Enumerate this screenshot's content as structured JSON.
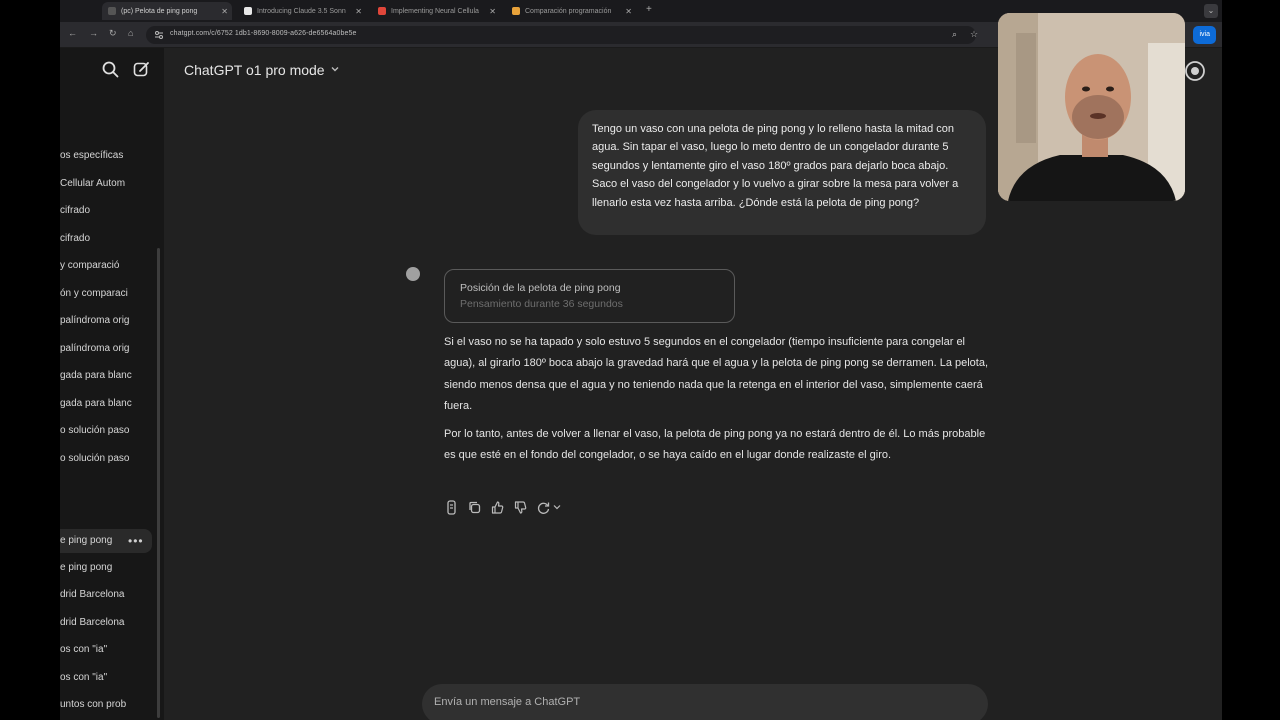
{
  "browser": {
    "tabs": [
      {
        "title": "(pc) Pelota de ping pong",
        "favicon_color": "#3a3a3a"
      },
      {
        "title": "Introducing Claude 3.5 Sonn",
        "favicon_color": "#e8e8e8"
      },
      {
        "title": "Implementing Neural Cellula",
        "favicon_color": "#e0463a"
      },
      {
        "title": "Comparación programación",
        "favicon_color": "#e8a23a"
      }
    ],
    "url": "chatgpt.com/c/6752 1db1-8690-8009-a626-de6564a0be5e",
    "share_label": "ivia"
  },
  "sidebar": {
    "items": [
      {
        "label": "os específicas"
      },
      {
        "label": "Cellular Autom"
      },
      {
        "label": "cifrado"
      },
      {
        "label": "cifrado"
      },
      {
        "label": "y comparació"
      },
      {
        "label": "ón y comparaci"
      },
      {
        "label": "palíndroma orig"
      },
      {
        "label": "palíndroma orig"
      },
      {
        "label": "gada para blanc"
      },
      {
        "label": "gada para blanc"
      },
      {
        "label": "o solución paso"
      },
      {
        "label": "o solución paso"
      }
    ],
    "recent": [
      {
        "label": "e ping pong"
      },
      {
        "label": "e ping pong"
      },
      {
        "label": "drid Barcelona"
      },
      {
        "label": "drid Barcelona"
      },
      {
        "label": "os con \"ia\""
      },
      {
        "label": "os con \"ia\""
      },
      {
        "label": "untos con prob"
      }
    ],
    "more_dots": "•••"
  },
  "header": {
    "model_title": "ChatGPT o1 pro mode"
  },
  "conversation": {
    "user_message": "Tengo un vaso con una pelota de ping pong y lo relleno hasta la mitad con agua. Sin tapar el vaso, luego lo meto dentro de un congelador durante 5 segundos y lentamente giro el vaso 180º grados para dejarlo boca abajo. Saco el vaso del congelador y lo vuelvo a girar sobre la mesa para volver a llenarlo esta vez hasta arriba. ¿Dónde está la pelota de ping pong?",
    "reasoning_title": "Posición de la pelota de ping pong",
    "reasoning_subtitle": "Pensamiento durante 36 segundos",
    "answer_p1": "Si el vaso no se ha tapado y solo estuvo 5 segundos en el congelador (tiempo insuficiente para congelar el agua), al girarlo 180º boca abajo la gravedad hará que el agua y la pelota de ping pong se derramen. La pelota, siendo menos densa que el agua y no teniendo nada que la retenga en el interior del vaso, simplemente caerá fuera.",
    "answer_p2": "Por lo tanto, antes de volver a llenar el vaso, la pelota de ping pong ya no estará dentro de él. Lo más probable es que esté en el fondo del congelador, o se haya caído en el lugar donde realizaste el giro."
  },
  "composer": {
    "placeholder": "Envía un mensaje a ChatGPT"
  },
  "colors": {
    "background": "#212121",
    "sidebar": "#171717",
    "bubble": "#2f2f2f",
    "accent": "#0d6bd8"
  }
}
